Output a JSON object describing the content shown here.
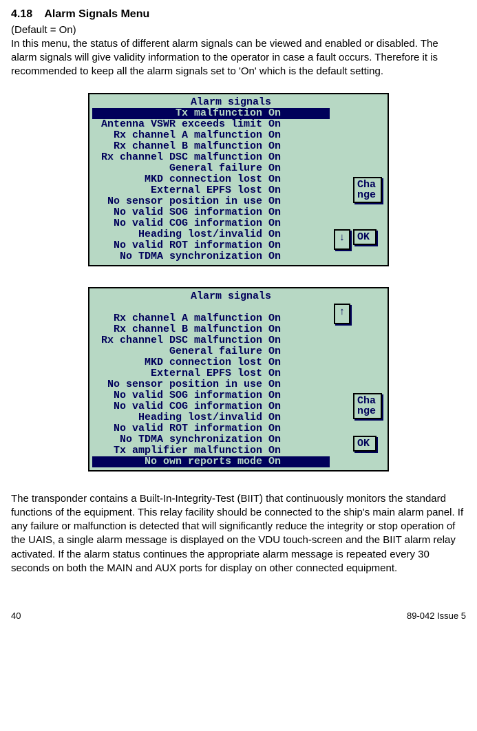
{
  "header": {
    "section_number": "4.18",
    "section_title": "Alarm Signals Menu",
    "default_note": "(Default = On)",
    "intro": "In this menu, the status of different alarm signals can be viewed and enabled or disabled. The alarm signals will give validity information to the operator in case a fault occurs. Therefore it is recommended to keep all the alarm signals set to 'On' which is the default setting."
  },
  "screen1": {
    "title": "Alarm signals",
    "rows": [
      {
        "label": "Tx malfunction",
        "status": "On",
        "selected": true
      },
      {
        "label": "Antenna VSWR exceeds limit",
        "status": "On",
        "selected": false
      },
      {
        "label": "Rx channel A malfunction",
        "status": "On",
        "selected": false
      },
      {
        "label": "Rx channel B malfunction",
        "status": "On",
        "selected": false
      },
      {
        "label": "Rx channel DSC malfunction",
        "status": "On",
        "selected": false
      },
      {
        "label": "General failure",
        "status": "On",
        "selected": false
      },
      {
        "label": "MKD connection lost",
        "status": "On",
        "selected": false
      },
      {
        "label": "External EPFS lost",
        "status": "On",
        "selected": false
      },
      {
        "label": "No sensor position in use",
        "status": "On",
        "selected": false
      },
      {
        "label": "No valid SOG information",
        "status": "On",
        "selected": false
      },
      {
        "label": "No valid COG information",
        "status": "On",
        "selected": false
      },
      {
        "label": "Heading lost/invalid",
        "status": "On",
        "selected": false
      },
      {
        "label": "No valid ROT information",
        "status": "On",
        "selected": false
      },
      {
        "label": "No TDMA synchronization",
        "status": "On",
        "selected": false
      }
    ],
    "buttons": {
      "change": "Cha\nnge",
      "ok": "OK",
      "down": "↓"
    }
  },
  "screen2": {
    "title": "Alarm signals",
    "rows": [
      {
        "label": "Rx channel A malfunction",
        "status": "On",
        "selected": false
      },
      {
        "label": "Rx channel B malfunction",
        "status": "On",
        "selected": false
      },
      {
        "label": "Rx channel DSC malfunction",
        "status": "On",
        "selected": false
      },
      {
        "label": "General failure",
        "status": "On",
        "selected": false
      },
      {
        "label": "MKD connection lost",
        "status": "On",
        "selected": false
      },
      {
        "label": "External EPFS lost",
        "status": "On",
        "selected": false
      },
      {
        "label": "No sensor position in use",
        "status": "On",
        "selected": false
      },
      {
        "label": "No valid SOG information",
        "status": "On",
        "selected": false
      },
      {
        "label": "No valid COG information",
        "status": "On",
        "selected": false
      },
      {
        "label": "Heading lost/invalid",
        "status": "On",
        "selected": false
      },
      {
        "label": "No valid ROT information",
        "status": "On",
        "selected": false
      },
      {
        "label": "No TDMA synchronization",
        "status": "On",
        "selected": false
      },
      {
        "label": "Tx amplifier malfunction",
        "status": "On",
        "selected": false
      },
      {
        "label": "No own reports mode",
        "status": "On",
        "selected": true
      }
    ],
    "buttons": {
      "change": "Cha\nnge",
      "ok": "OK",
      "up": "↑"
    }
  },
  "body2": "The transponder contains a Built-In-Integrity-Test (BIIT) that continuously monitors the standard functions of the equipment. This relay facility should be connected to the ship's main alarm panel. If any failure or malfunction is detected that will significantly reduce the integrity or stop operation of the UAIS, a single alarm message is displayed on the VDU touch-screen and the BIIT alarm relay activated. If the alarm status continues the appropriate alarm message is repeated every 30 seconds on both the MAIN and AUX ports for display on other connected equipment.",
  "footer": {
    "page": "40",
    "doc": "89-042 Issue 5"
  }
}
